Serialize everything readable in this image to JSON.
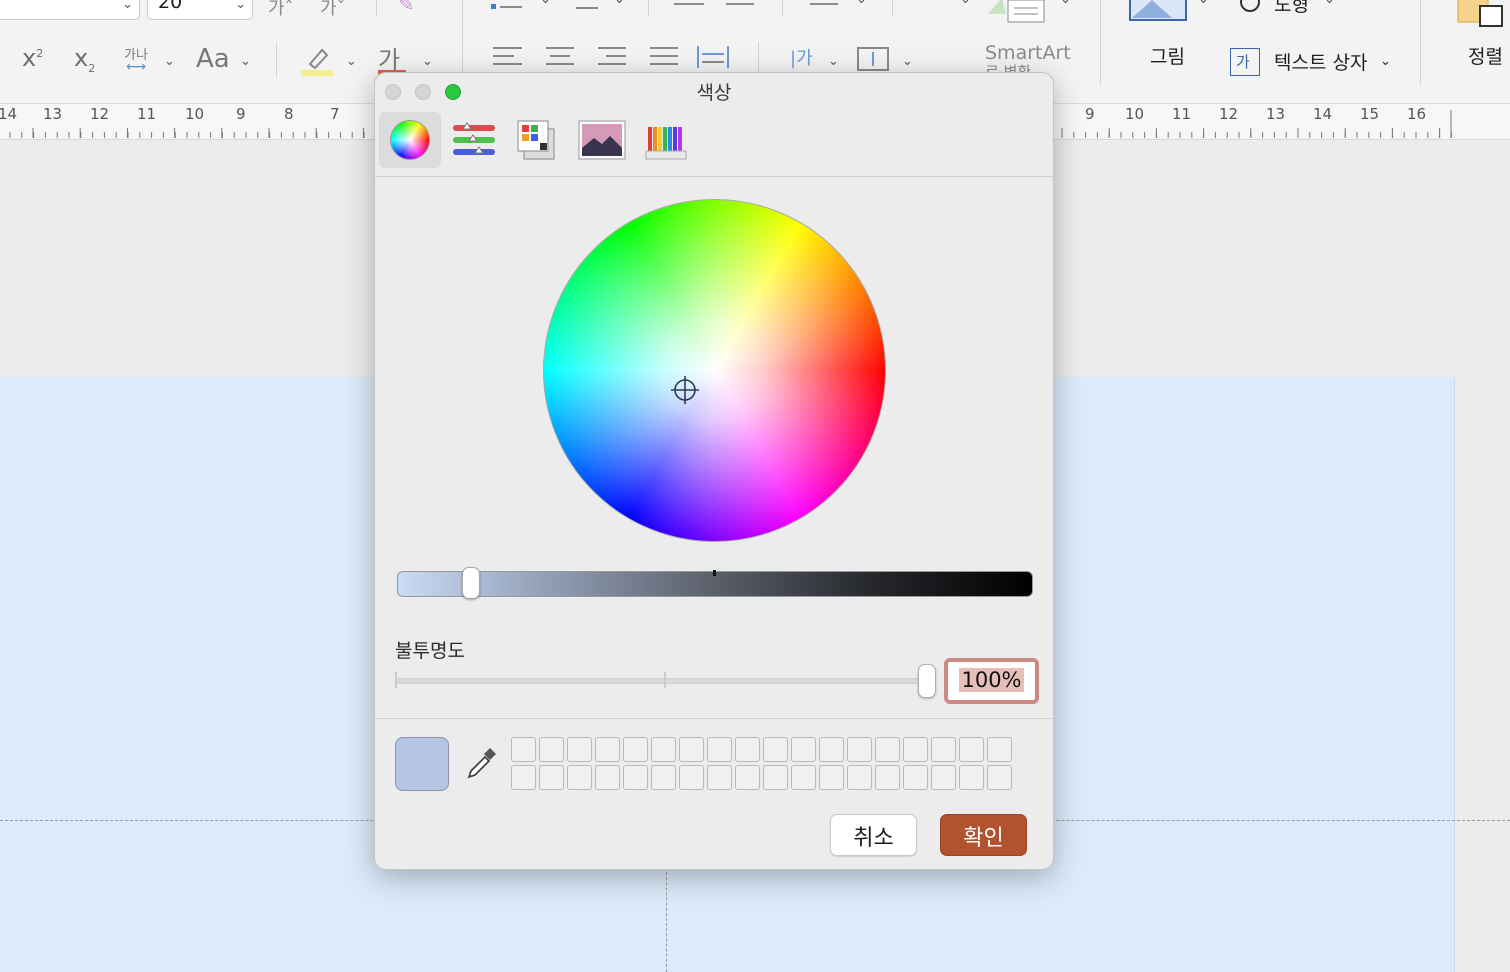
{
  "ribbon": {
    "font_size_value": "20",
    "superscript_label": "x",
    "superscript_exp": "2",
    "subscript_label": "x",
    "subscript_exp": "2",
    "char_spacing_label": "가나",
    "change_case_label": "Aa",
    "font_color_label": "가",
    "smartart_label": "SmartArt",
    "smartart_sub": "로 변환",
    "picture_label": "그림",
    "shape_label": "도형",
    "textbox_icon_label": "가",
    "textbox_label": "텍스트 상자",
    "arrange_label": "정렬",
    "highlight_color": "#f3ef8a",
    "font_color": "#e06050"
  },
  "ruler": {
    "left_labels": [
      "14",
      "13",
      "12",
      "11",
      "10",
      "9",
      "8",
      "7"
    ],
    "right_labels": [
      "9",
      "10",
      "11",
      "12",
      "13",
      "14",
      "15",
      "16"
    ]
  },
  "dialog": {
    "title": "색상",
    "modes": [
      "color-wheel",
      "color-sliders",
      "color-palettes",
      "image-palettes",
      "pencils"
    ],
    "selected_mode": "color-wheel",
    "brightness_level": 0.12,
    "opacity_label": "불투명도",
    "opacity_value": "100%",
    "opacity_level": 1.0,
    "current_color": "#b4c6e3",
    "cancel_label": "취소",
    "ok_label": "확인"
  }
}
